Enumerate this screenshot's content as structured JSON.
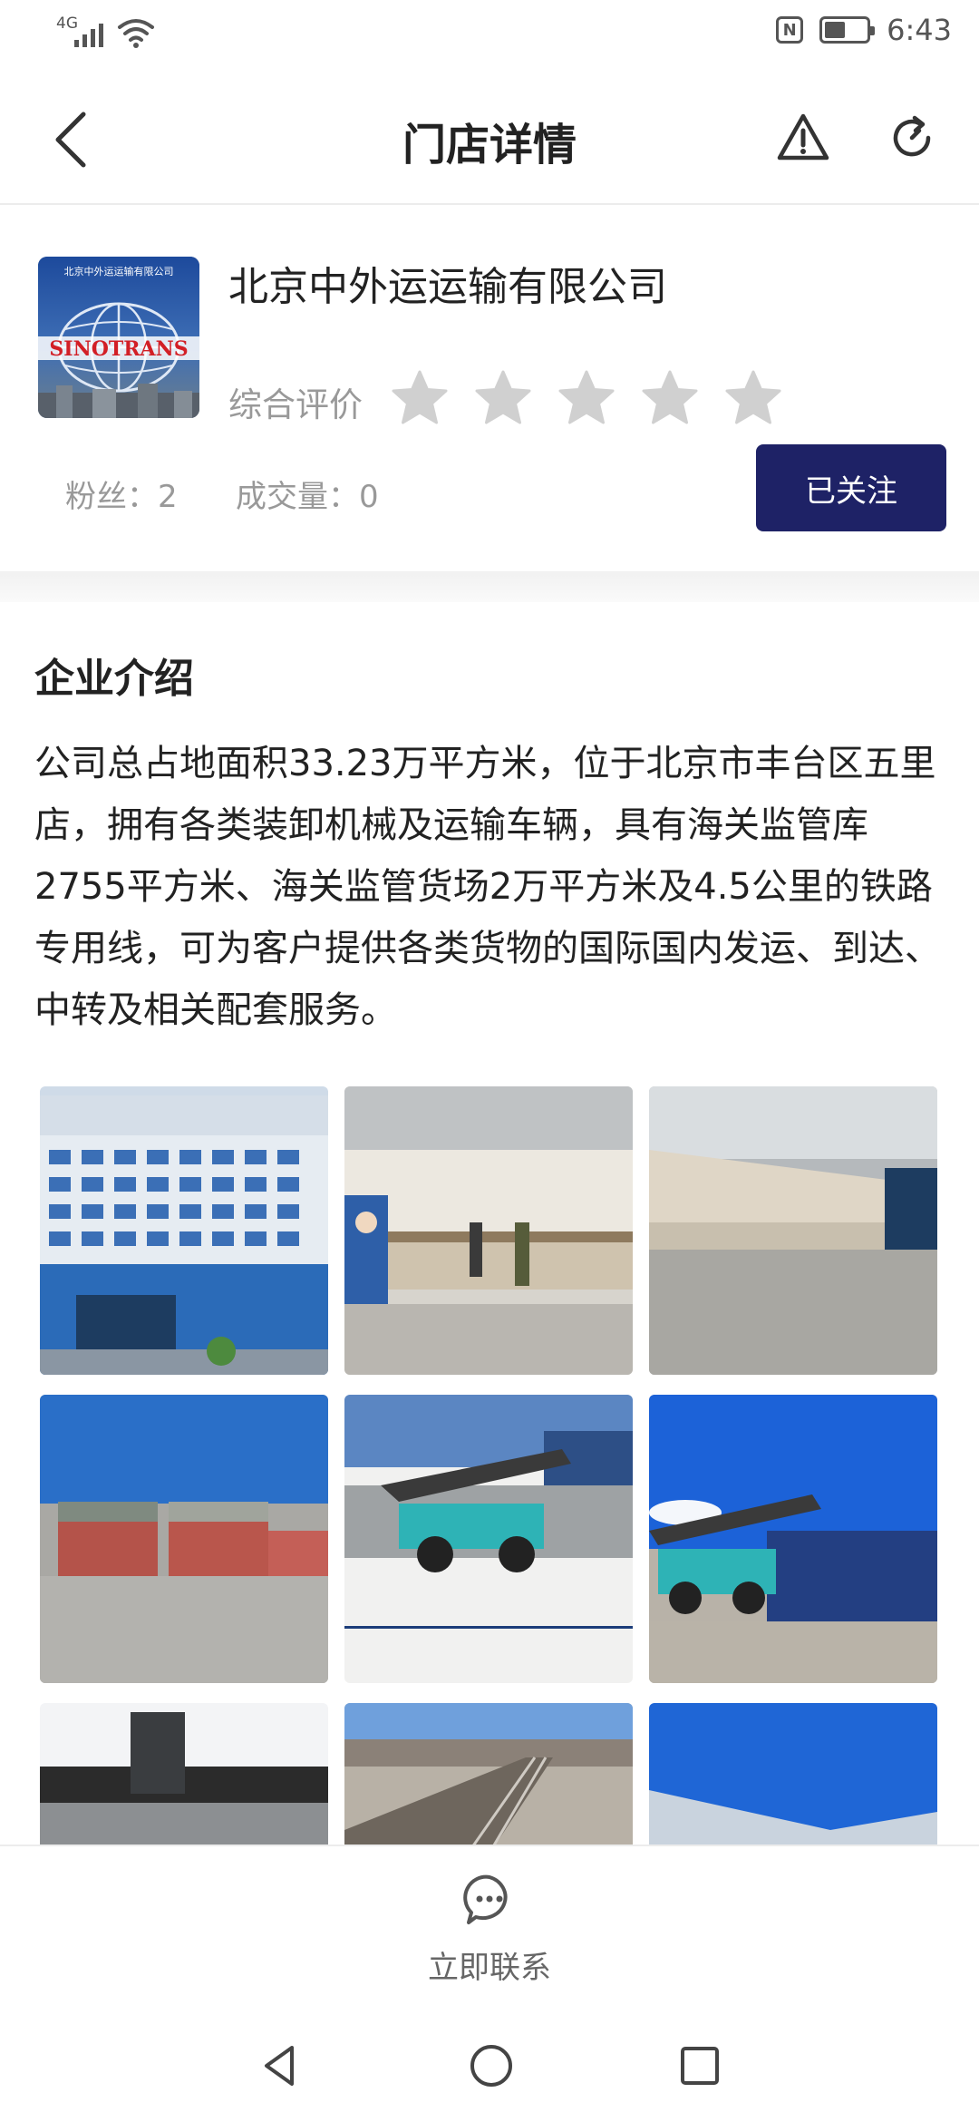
{
  "status_bar": {
    "network": "4G",
    "nfc": "N",
    "time": "6:43"
  },
  "header": {
    "title": "门店详情"
  },
  "store": {
    "logo_text": "北京中外运运输有限公司",
    "logo_brand": "SINOTRANS",
    "name": "北京中外运运输有限公司",
    "rating_label": "综合评价",
    "rating": 0,
    "rating_max": 5,
    "fans_label": "粉丝：2",
    "deals_label": "成交量：0",
    "follow_label": "已关注"
  },
  "intro": {
    "title": "企业介绍",
    "text": "公司总占地面积33.23万平方米，位于北京市丰台区五里店，拥有各类装卸机械及运输车辆，具有海关监管库2755平方米、海关监管货场2万平方米及4.5公里的铁路专用线，可为客户提供各类货物的国际国内发运、到达、中转及相关配套服务。"
  },
  "gallery": {
    "photos": [
      {
        "name": "building-photo"
      },
      {
        "name": "service-hall-photo"
      },
      {
        "name": "warehouse-photo"
      },
      {
        "name": "container-yard-photo"
      },
      {
        "name": "reach-stacker-photo"
      },
      {
        "name": "reach-stacker-blue-sky-photo"
      },
      {
        "name": "crane-photo"
      },
      {
        "name": "railway-photo"
      },
      {
        "name": "warehouse-roof-photo"
      }
    ]
  },
  "bottom": {
    "contact_label": "立即联系"
  },
  "icons": {
    "back": "back-arrow-icon",
    "warning": "warning-icon",
    "refresh": "refresh-icon",
    "star": "star-icon",
    "chat": "chat-bubble-icon"
  },
  "colors": {
    "primary": "#1e2266",
    "star_empty": "#d0d0d0",
    "muted_text": "#999999"
  }
}
